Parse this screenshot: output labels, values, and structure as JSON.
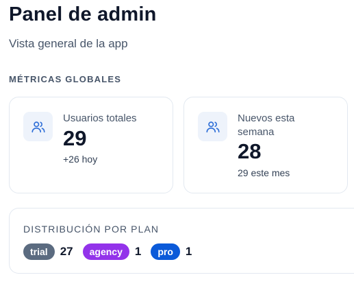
{
  "header": {
    "title": "Panel de admin",
    "subtitle": "Vista general de la app"
  },
  "metrics": {
    "section_title": "MÉTRICAS GLOBALES",
    "cards": [
      {
        "icon": "users-icon",
        "label": "Usuarios totales",
        "value": "29",
        "sub": "+26 hoy"
      },
      {
        "icon": "users-icon",
        "label": "Nuevos esta semana",
        "value": "28",
        "sub": "29 este mes"
      }
    ]
  },
  "plans": {
    "title": "DISTRIBUCIÓN POR PLAN",
    "items": [
      {
        "name": "trial",
        "count": "27",
        "color": "#5b6b80"
      },
      {
        "name": "agency",
        "count": "1",
        "color": "#9333ea"
      },
      {
        "name": "pro",
        "count": "1",
        "color": "#0b5ad9"
      }
    ]
  },
  "colors": {
    "icon": "#2f6fd8",
    "icon_bg": "#eef3fb"
  }
}
